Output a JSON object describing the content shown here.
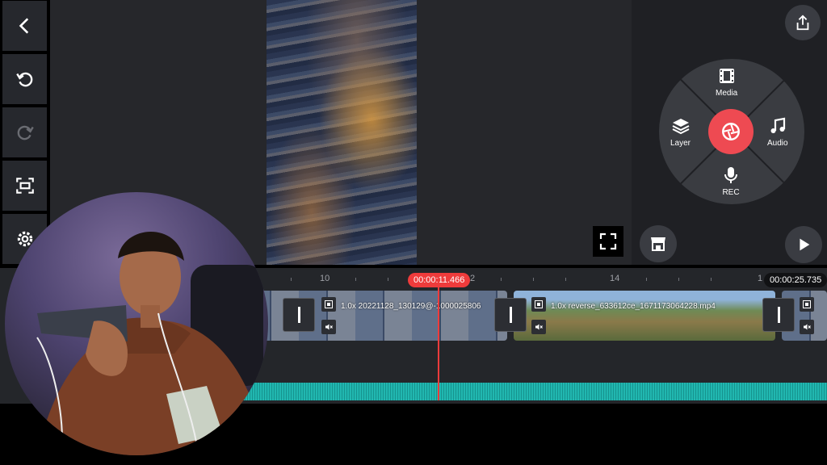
{
  "left_toolbar": {
    "back_icon": "chevron-left-icon",
    "undo_icon": "undo-icon",
    "redo_icon": "redo-icon",
    "capture_icon": "screen-capture-icon",
    "settings_icon": "gear-icon"
  },
  "right_panel": {
    "share_icon": "share-icon",
    "wheel": {
      "media_label": "Media",
      "layer_label": "Layer",
      "audio_label": "Audio",
      "rec_label": "REC"
    },
    "store_icon": "asset-store-icon",
    "play_icon": "play-icon"
  },
  "timeline": {
    "ruler": [
      "10",
      "2",
      "14",
      "1"
    ],
    "current_time": "00:00:11.466",
    "total_time": "00:00:25.735",
    "clips": [
      {
        "label": "1.0x 20221128_130129@-1000025806"
      },
      {
        "label": "1.0x reverse_633612ce_1671173064228.mp4"
      }
    ]
  },
  "colors": {
    "accent": "#ee4a52",
    "panel": "#26282d",
    "audio": "#21b7b0"
  }
}
